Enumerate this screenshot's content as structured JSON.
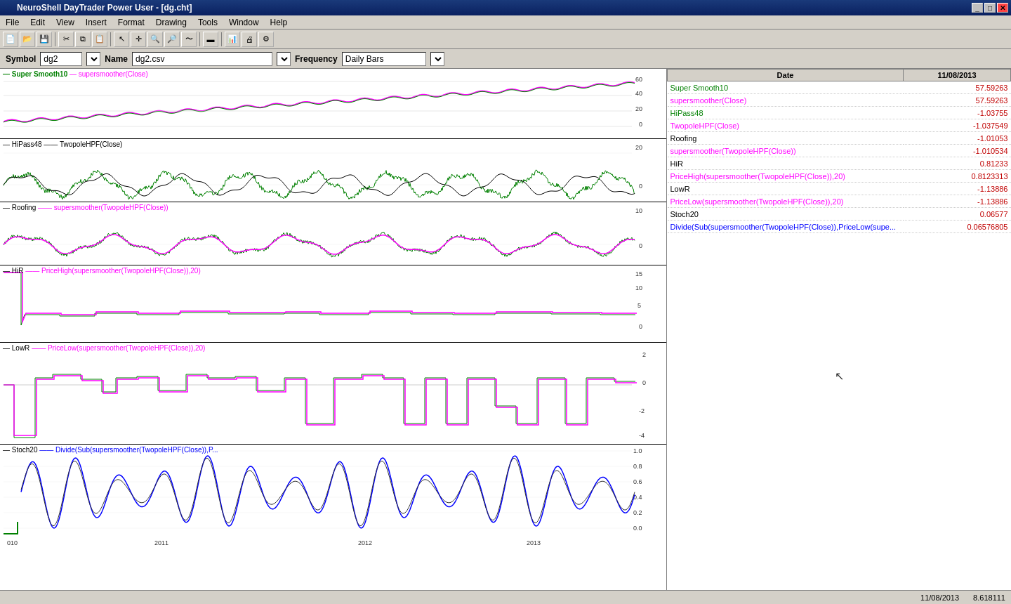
{
  "titleBar": {
    "title": "NeuroShell DayTrader Power User - [dg.cht]",
    "controls": [
      "_",
      "□",
      "✕"
    ]
  },
  "menuBar": {
    "items": [
      "File",
      "Edit",
      "View",
      "Insert",
      "Format",
      "Drawing",
      "Tools",
      "Window",
      "Help"
    ]
  },
  "symbolBar": {
    "symbolLabel": "Symbol",
    "symbolValue": "dg2",
    "nameLabel": "Name",
    "nameValue": "dg2.csv",
    "frequencyLabel": "Frequency",
    "frequencyValue": "Daily Bars"
  },
  "chartPanels": [
    {
      "id": "panel1",
      "height": 100,
      "label1": "Super Smooth10",
      "label1Color": "green",
      "label2": "supersmoother(Close)",
      "label2Color": "magenta",
      "yLabels": [
        "60",
        "40",
        "20",
        "0"
      ],
      "lineColor1": "green",
      "lineColor2": "magenta"
    },
    {
      "id": "panel2",
      "height": 90,
      "label1": "HiPass48",
      "label1Color": "black",
      "label2": "TwopoleHPF(Close)",
      "label2Color": "black",
      "yLabels": [
        "20",
        "0"
      ],
      "lineColor1": "green",
      "lineColor2": "black"
    },
    {
      "id": "panel3",
      "height": 90,
      "label1": "Roofing",
      "label1Color": "black",
      "label2": "supersmoother(TwopoleHPF(Close))",
      "label2Color": "magenta",
      "yLabels": [
        "10",
        "0"
      ],
      "lineColor1": "green",
      "lineColor2": "magenta"
    },
    {
      "id": "panel4",
      "height": 110,
      "label1": "HiR",
      "label1Color": "black",
      "label2": "PriceHigh(supersmoother(TwopoleHPF(Close)),20)",
      "label2Color": "magenta",
      "yLabels": [
        "15",
        "10",
        "5",
        "0"
      ],
      "lineColor1": "green",
      "lineColor2": "magenta"
    },
    {
      "id": "panel5",
      "height": 145,
      "label1": "LowR",
      "label1Color": "black",
      "label2": "PriceLow(supersmoother(TwopoleHPF(Close)),20)",
      "label2Color": "magenta",
      "yLabels": [
        "2",
        "0",
        "-2",
        "-4"
      ],
      "lineColor1": "green",
      "lineColor2": "magenta"
    },
    {
      "id": "panel6",
      "height": 145,
      "label1": "Stoch20",
      "label1Color": "black",
      "label2": "Divide(Sub(supersmoother(TwopoleHPF(Close)),P...",
      "label2Color": "blue",
      "yLabels": [
        "1.0",
        "0.8",
        "0.6",
        "0.4",
        "0.2",
        "0.0"
      ],
      "lineColor1": "green",
      "lineColor2": "blue",
      "xLabels": [
        "010",
        "2011",
        "2012",
        "2013"
      ]
    }
  ],
  "dataTable": {
    "headers": [
      "Date",
      "11/08/2013"
    ],
    "rows": [
      {
        "name": "Super Smooth10",
        "nameColor": "green",
        "value": "57.59263"
      },
      {
        "name": "supersmoother(Close)",
        "nameColor": "magenta",
        "value": "57.59263"
      },
      {
        "name": "HiPass48",
        "nameColor": "green",
        "value": "-1.03755"
      },
      {
        "name": "TwopoleHPF(Close)",
        "nameColor": "magenta",
        "value": "-1.037549"
      },
      {
        "name": "Roofing",
        "nameColor": "black",
        "value": "-1.01053"
      },
      {
        "name": "supersmoother(TwopoleHPF(Close))",
        "nameColor": "magenta",
        "value": "-1.010534"
      },
      {
        "name": "HiR",
        "nameColor": "black",
        "value": "0.81233"
      },
      {
        "name": "PriceHigh(supersmoother(TwopoleHPF(Close)),20)",
        "nameColor": "magenta",
        "value": "0.8123313"
      },
      {
        "name": "LowR",
        "nameColor": "black",
        "value": "-1.13886"
      },
      {
        "name": "PriceLow(supersmoother(TwopoleHPF(Close)),20)",
        "nameColor": "magenta",
        "value": "-1.13886"
      },
      {
        "name": "Stoch20",
        "nameColor": "black",
        "value": "0.06577"
      },
      {
        "name": "Divide(Sub(supersmoother(TwopoleHPF(Close)),PriceLow(supe...",
        "nameColor": "blue",
        "value": "0.06576805"
      }
    ]
  },
  "statusBar": {
    "date": "11/08/2013",
    "value": "8.618111"
  }
}
